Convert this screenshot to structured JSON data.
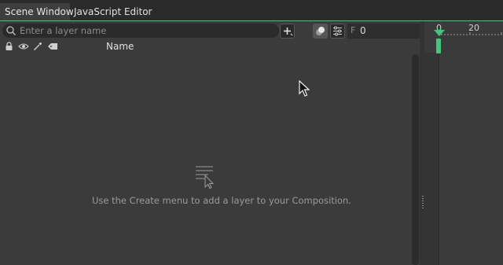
{
  "tabs": [
    {
      "label": "Scene Window",
      "active": true
    },
    {
      "label": "JavaScript Editor",
      "active": false
    }
  ],
  "search": {
    "placeholder": "Enter a layer name",
    "value": ""
  },
  "toolbar": {
    "add_icon": "plus-icon",
    "solo_icon": "solo-toggle-icon",
    "filter_icon": "sliders-icon"
  },
  "frame": {
    "label": "F",
    "value": "0"
  },
  "columns": {
    "icons": [
      "lock-icon",
      "eye-icon",
      "eyedropper-icon",
      "tag-icon"
    ],
    "name_label": "Name"
  },
  "timeline": {
    "tick_labels": [
      "0",
      "20"
    ]
  },
  "empty_state": {
    "icon": "add-layer-cursor-icon",
    "message": "Use the Create menu to add a layer to your Composition."
  },
  "colors": {
    "accent": "#3ec77e",
    "bg": "#3b3b3b",
    "tabbar": "#2b2b2b"
  }
}
